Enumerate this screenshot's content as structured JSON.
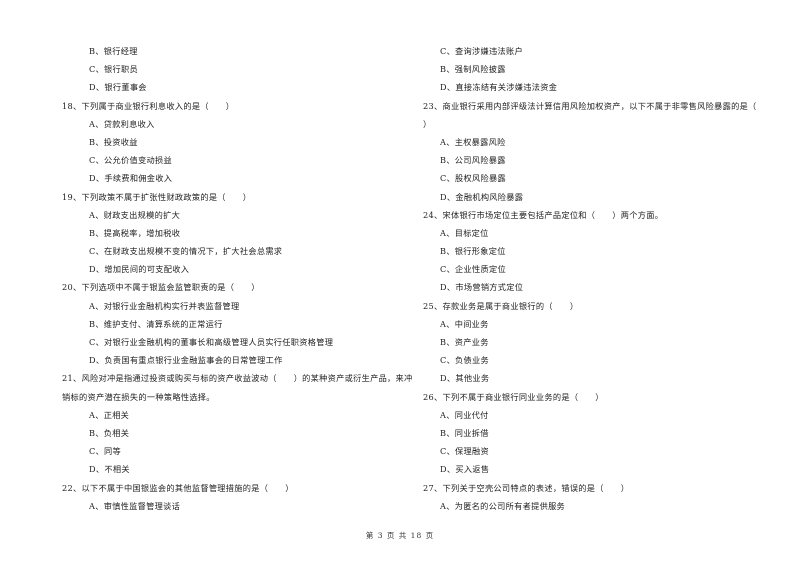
{
  "left_column": [
    {
      "type": "opt",
      "text": "B、银行经理"
    },
    {
      "type": "opt",
      "text": "C、银行职员"
    },
    {
      "type": "opt",
      "text": "D、银行董事会"
    },
    {
      "type": "q",
      "text": "18、下列属于商业银行利息收入的是（　　）"
    },
    {
      "type": "opt",
      "text": "A、贷款利息收入"
    },
    {
      "type": "opt",
      "text": "B、投资收益"
    },
    {
      "type": "opt",
      "text": "C、公允价值变动损益"
    },
    {
      "type": "opt",
      "text": "D、手续费和佣金收入"
    },
    {
      "type": "q",
      "text": "19、下列政策不属于扩张性财政政策的是（　　）"
    },
    {
      "type": "opt",
      "text": "A、财政支出规模的扩大"
    },
    {
      "type": "opt",
      "text": "B、提高税率，增加税收"
    },
    {
      "type": "opt",
      "text": "C、在财政支出规模不变的情况下，扩大社会总需求"
    },
    {
      "type": "opt",
      "text": "D、增加民间的可支配收入"
    },
    {
      "type": "q",
      "text": "20、下列选项中不属于银监会监管职责的是（　　）"
    },
    {
      "type": "opt",
      "text": "A、对银行业金融机构实行并表监督管理"
    },
    {
      "type": "opt",
      "text": "B、维护支付、清算系统的正常运行"
    },
    {
      "type": "opt",
      "text": "C、对银行业金融机构的董事长和高级管理人员实行任职资格管理"
    },
    {
      "type": "opt",
      "text": "D、负责国有重点银行业金融监事会的日常管理工作"
    },
    {
      "type": "q",
      "text": "21、风险对冲是指通过投资或购买与标的资产收益波动（　　）的某种资产或衍生产品，来冲"
    },
    {
      "type": "cont",
      "text": "销标的资产潜在损失的一种策略性选择。"
    },
    {
      "type": "opt",
      "text": "A、正相关"
    },
    {
      "type": "opt",
      "text": "B、负相关"
    },
    {
      "type": "opt",
      "text": "C、同等"
    },
    {
      "type": "opt",
      "text": "D、不相关"
    },
    {
      "type": "q",
      "text": "22、以下不属于中国银监会的其他监督管理措施的是（　　）"
    },
    {
      "type": "opt",
      "text": "A、审慎性监督管理谈话"
    }
  ],
  "right_column": [
    {
      "type": "opt",
      "text": "C、查询涉嫌违法账户"
    },
    {
      "type": "opt",
      "text": "B、强制风险披露"
    },
    {
      "type": "opt",
      "text": "D、直接冻结有关涉嫌违法资金"
    },
    {
      "type": "q",
      "text": "23、商业银行采用内部评级法计算信用风险加权资产，以下不属于非零售风险暴露的是（"
    },
    {
      "type": "cont",
      "text": "）"
    },
    {
      "type": "opt",
      "text": "A、主权暴露风险"
    },
    {
      "type": "opt",
      "text": "B、公司风险暴露"
    },
    {
      "type": "opt",
      "text": "C、股权风险暴露"
    },
    {
      "type": "opt",
      "text": "D、金融机构风险暴露"
    },
    {
      "type": "q",
      "text": "24、宋体银行市场定位主要包括产品定位和（　　）两个方面。"
    },
    {
      "type": "opt",
      "text": "A、目标定位"
    },
    {
      "type": "opt",
      "text": "B、银行形象定位"
    },
    {
      "type": "opt",
      "text": "C、企业性质定位"
    },
    {
      "type": "opt",
      "text": "D、市场营销方式定位"
    },
    {
      "type": "q",
      "text": "25、存款业务是属于商业银行的（　　）"
    },
    {
      "type": "opt",
      "text": "A、中间业务"
    },
    {
      "type": "opt",
      "text": "B、资产业务"
    },
    {
      "type": "opt",
      "text": "C、负债业务"
    },
    {
      "type": "opt",
      "text": "D、其他业务"
    },
    {
      "type": "q",
      "text": "26、下列不属于商业银行同业业务的是（　　）"
    },
    {
      "type": "opt",
      "text": "A、同业代付"
    },
    {
      "type": "opt",
      "text": "B、同业拆借"
    },
    {
      "type": "opt",
      "text": "C、保理融资"
    },
    {
      "type": "opt",
      "text": "D、买入返售"
    },
    {
      "type": "q",
      "text": "27、下列关于空壳公司特点的表述，错误的是（　　）"
    },
    {
      "type": "opt",
      "text": "A、为匿名的公司所有者提供服务"
    }
  ],
  "footer": {
    "text": "第 3 页 共 18 页"
  }
}
